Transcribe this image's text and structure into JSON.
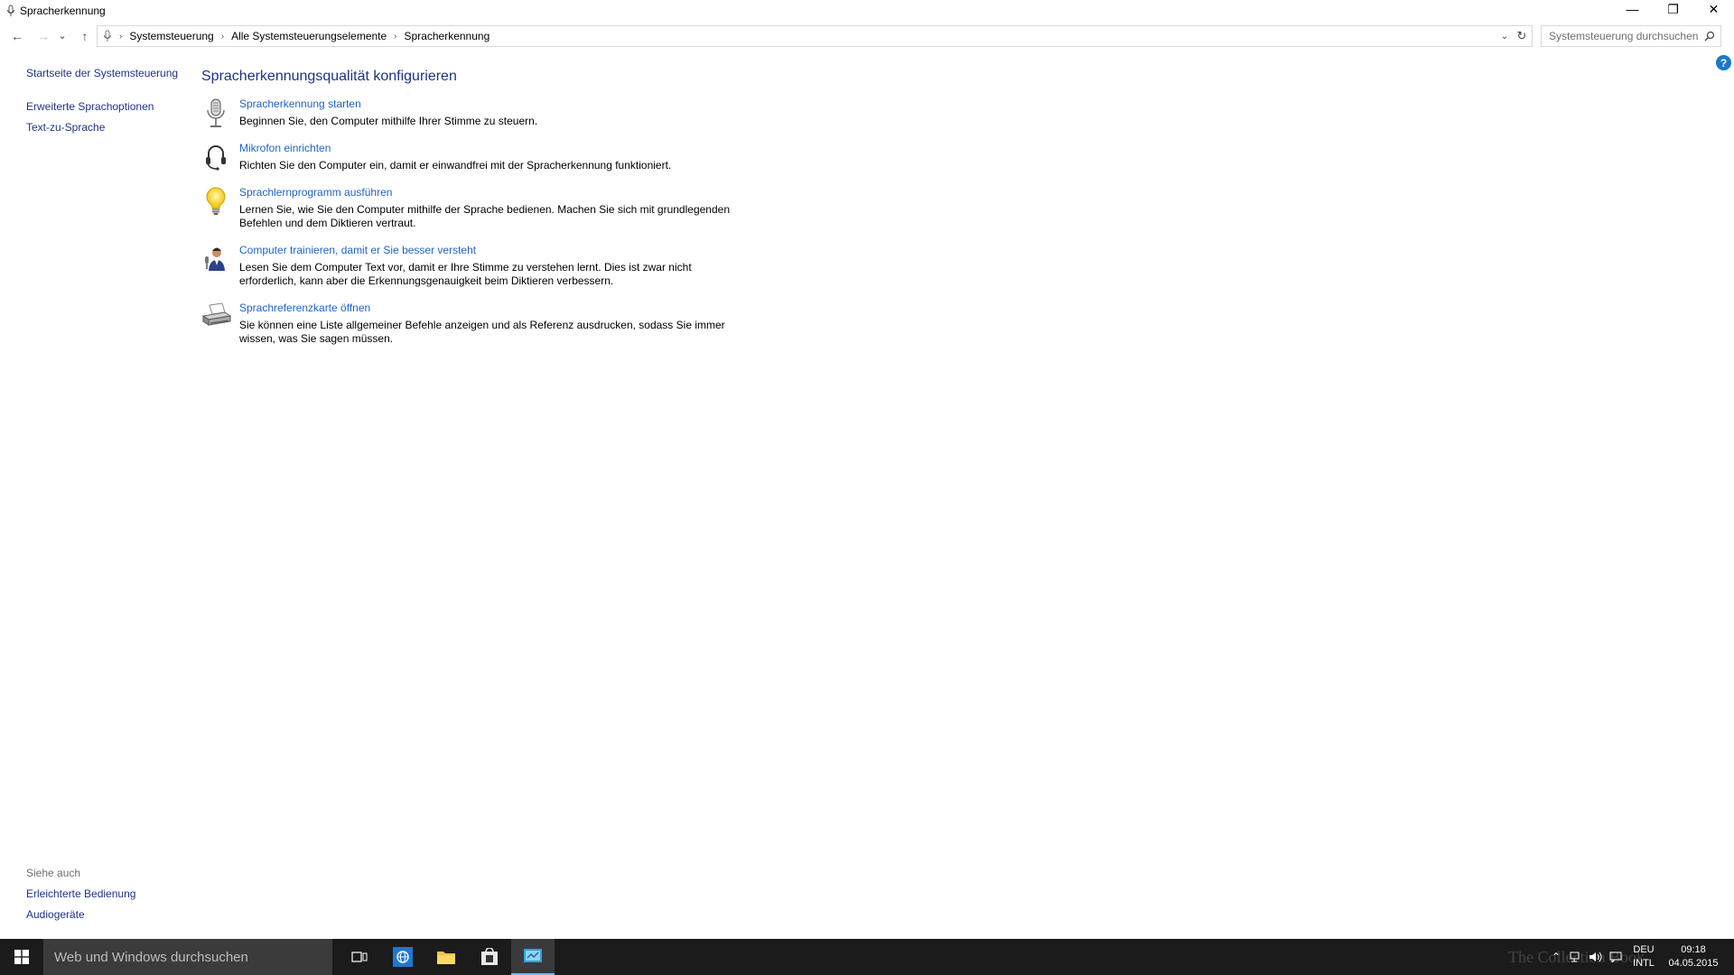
{
  "window": {
    "title": "Spracherkennung",
    "controls": {
      "minimize": "—",
      "restore": "❐",
      "close": "✕"
    }
  },
  "navigation": {
    "back": "←",
    "forward": "→",
    "recent": "⌄",
    "up": "↑",
    "breadcrumbs": [
      "Systemsteuerung",
      "Alle Systemsteuerungselemente",
      "Spracherkennung"
    ],
    "separator": "›",
    "dropdown": "⌄",
    "refresh": "↻"
  },
  "search": {
    "placeholder": "Systemsteuerung durchsuchen"
  },
  "sidebar": {
    "home": "Startseite der Systemsteuerung",
    "items": [
      {
        "label": "Erweiterte Sprachoptionen"
      },
      {
        "label": "Text-zu-Sprache"
      }
    ]
  },
  "help": {
    "label": "?"
  },
  "main": {
    "title": "Spracherkennungsqualität konfigurieren",
    "tasks": [
      {
        "link": "Spracherkennung starten",
        "desc": "Beginnen Sie, den Computer mithilfe Ihrer Stimme zu steuern.",
        "icon": "microphone-icon"
      },
      {
        "link": "Mikrofon einrichten",
        "desc": "Richten Sie den Computer ein, damit er einwandfrei mit der Spracherkennung funktioniert.",
        "icon": "headset-icon"
      },
      {
        "link": "Sprachlernprogramm ausführen",
        "desc": "Lernen Sie, wie Sie den Computer mithilfe der Sprache bedienen. Machen Sie sich mit grundlegenden Befehlen und dem Diktieren vertraut.",
        "icon": "lightbulb-icon"
      },
      {
        "link": "Computer trainieren, damit er Sie besser versteht",
        "desc": "Lesen Sie dem Computer Text vor, damit er Ihre Stimme zu verstehen lernt. Dies ist zwar nicht erforderlich, kann aber die Erkennungsgenauigkeit beim Diktieren verbessern.",
        "icon": "user-speaking-icon"
      },
      {
        "link": "Sprachreferenzkarte öffnen",
        "desc": "Sie können eine Liste allgemeiner Befehle anzeigen und als Referenz ausdrucken, sodass Sie immer wissen, was Sie sagen müssen.",
        "icon": "printer-icon"
      }
    ]
  },
  "see_also": {
    "title": "Siehe auch",
    "items": [
      {
        "label": "Erleichterte Bedienung"
      },
      {
        "label": "Audiogeräte"
      }
    ]
  },
  "taskbar": {
    "search_placeholder": "Web und Windows durchsuchen",
    "apps": [
      "task-view-icon",
      "browser-icon",
      "file-explorer-icon",
      "store-icon",
      "control-panel-icon"
    ],
    "tray": {
      "lang_top": "DEU",
      "lang_bottom": "INTL",
      "time": "09:18",
      "date": "04.05.2015"
    },
    "watermark": "The Collection Book"
  },
  "colors": {
    "link": "#1e64c8",
    "heading": "#1e3287",
    "taskbar": "#1b1b1b",
    "accent": "#76b9ed"
  }
}
